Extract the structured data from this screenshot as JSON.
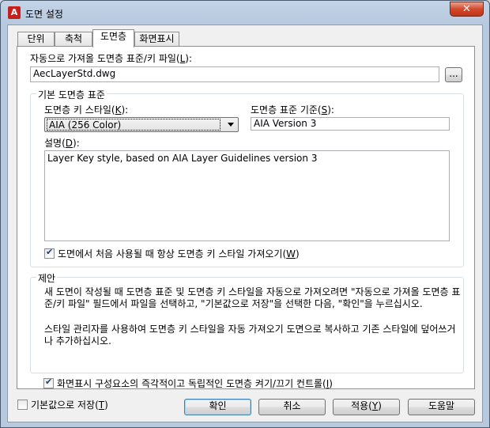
{
  "window": {
    "title": "도면 설정",
    "close_glyph": "✕"
  },
  "tabs": [
    {
      "label": "단위"
    },
    {
      "label": "축척"
    },
    {
      "label": "도면층"
    },
    {
      "label": "화면표시"
    }
  ],
  "auto_import": {
    "label": "자동으로 가져올 도면층 표준/키 파일(",
    "label_key": "L",
    "label_end": "):",
    "value": "AecLayerStd.dwg",
    "browse_label": "..."
  },
  "standards_group": {
    "title": "기본 도면층 표준",
    "key_style_label": "도면층 키 스타일(",
    "key_style_key": "K",
    "key_style_end": "):",
    "key_style_value": "AIA (256 Color)",
    "standard_label": "도면층 표준 기준(",
    "standard_key": "S",
    "standard_end": "):",
    "standard_value": "AIA Version 3",
    "description_label": "설명(",
    "description_key": "D",
    "description_end": "):",
    "description_value": "Layer Key style, based on AIA Layer Guidelines version 3",
    "always_import_label": "도면에서 처음 사용될 때 항상 도면층 키 스타일 가져오기(",
    "always_import_key": "W",
    "always_import_end": ")",
    "always_import_checked": true
  },
  "tips": {
    "title": "제안",
    "text1": "새 도면이 작성될 때 도면층 표준 및 도면층 키 스타일을 자동으로 가져오려면 \"자동으로 가져올 도면층 표준/키 파일\" 필드에서 파일을 선택하고, \"기본값으로 저장\"을 선택한 다음, \"확인\"을 누르십시오.",
    "text2": "스타일 관리자를 사용하여 도면층 키 스타일을 자동 가져오기 도면으로 복사하고 기존 스타일에 덮어쓰거나 추가하십시오."
  },
  "independent": {
    "label": "화면표시 구성요소의 즉각적이고 독립적인 도면층 켜기/끄기 컨트롤(",
    "key": "I",
    "end": ")",
    "checked": true
  },
  "footer": {
    "save_default_label": "기본값으로 저장(",
    "save_default_key": "T",
    "save_default_end": ")",
    "ok": "확인",
    "cancel": "취소",
    "apply": "적용(",
    "apply_key": "Y",
    "apply_end": ")",
    "help": "도움말"
  }
}
